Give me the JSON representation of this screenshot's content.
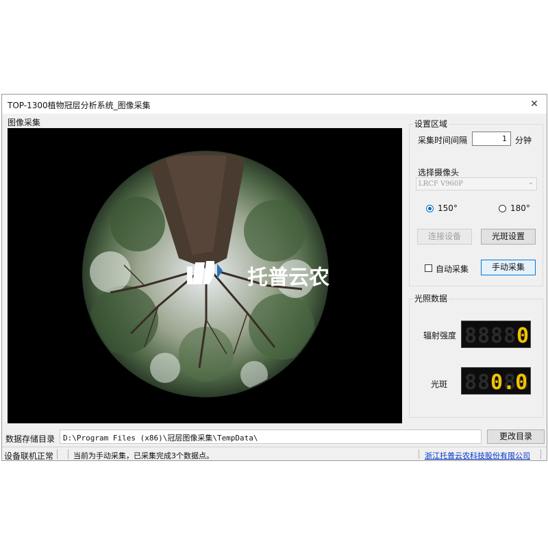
{
  "window": {
    "title": "TOP-1300植物冠层分析系统_图像采集",
    "close_glyph": "✕"
  },
  "preview": {
    "group_label": "图像采集",
    "watermark_text": "托普云农"
  },
  "settings": {
    "group_label": "设置区域",
    "interval_label": "采集时间间隔",
    "interval_value": "1",
    "interval_unit": "分钟",
    "camera_label": "选择摄像头",
    "camera_value": "LRCF V960P",
    "radio_150": "150°",
    "radio_180": "180°",
    "radio_selected": "150°",
    "connect_button": "连接设备",
    "spot_settings_button": "光斑设置",
    "auto_capture_label": "自动采集",
    "auto_capture_checked": false,
    "manual_capture_button": "手动采集"
  },
  "light": {
    "group_label": "光照数据",
    "radiation_label": "辐射强度",
    "radiation_value": "0",
    "spot_label": "光斑",
    "spot_value": "0.0"
  },
  "storage": {
    "label": "数据存储目录",
    "path": "D:\\Program Files (x86)\\冠层图像采集\\TempData\\",
    "change_button": "更改目录"
  },
  "status": {
    "device": "设备联机正常",
    "message": "当前为手动采集，已采集完成3个数据点。",
    "company_link": "浙江托普云农科技股份有限公司"
  },
  "colors": {
    "segment_on": "#f2c200",
    "segment_off": "#2b2b2b",
    "link": "#0033cc",
    "accent": "#0067c0"
  }
}
